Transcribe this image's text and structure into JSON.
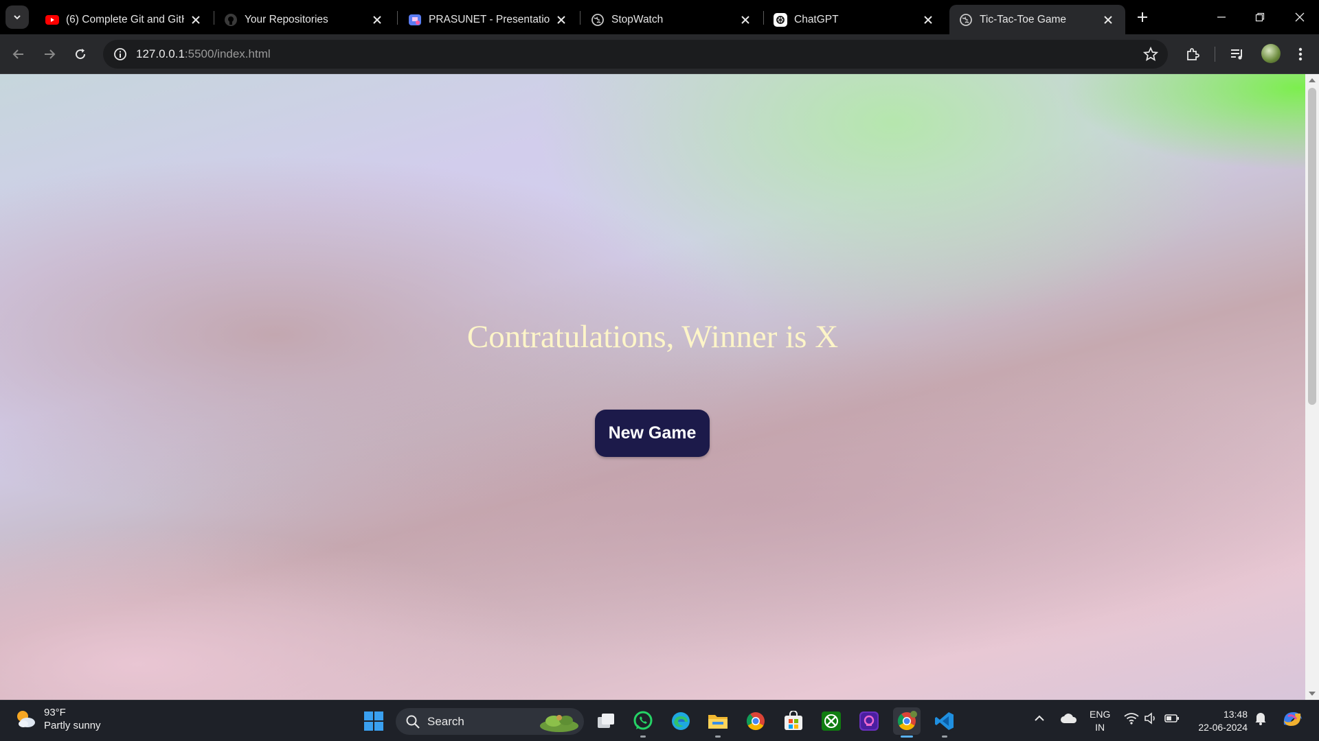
{
  "browser": {
    "tabs": [
      {
        "title": "(6) Complete Git and GitHub",
        "favicon": "youtube-icon",
        "active": false
      },
      {
        "title": "Your Repositories",
        "favicon": "github-icon",
        "active": false
      },
      {
        "title": "PRASUNET - Presentation",
        "favicon": "presentation-icon",
        "active": false
      },
      {
        "title": "StopWatch",
        "favicon": "globe-icon",
        "active": false
      },
      {
        "title": "ChatGPT",
        "favicon": "chatgpt-icon",
        "active": false
      },
      {
        "title": "Tic-Tac-Toe Game",
        "favicon": "globe-icon",
        "active": true
      }
    ],
    "address": {
      "host": "127.0.0.1",
      "path": ":5500/index.html"
    }
  },
  "page": {
    "winner_message": "Contratulations, Winner is X",
    "new_game_label": "New Game"
  },
  "taskbar": {
    "weather": {
      "temperature": "93°F",
      "condition": "Partly sunny"
    },
    "search_label": "Search",
    "apps": [
      "task-view",
      "whatsapp",
      "edge",
      "file-explorer",
      "chrome",
      "microsoft-store",
      "xbox",
      "app-purple",
      "chrome-active",
      "vscode"
    ],
    "language": {
      "line1": "ENG",
      "line2": "IN"
    },
    "clock": {
      "time": "13:48",
      "date": "22-06-2024"
    }
  },
  "colors": {
    "page_text": "#fdf5c8",
    "button_bg": "#1c1a4a",
    "button_text": "#ffffff"
  }
}
